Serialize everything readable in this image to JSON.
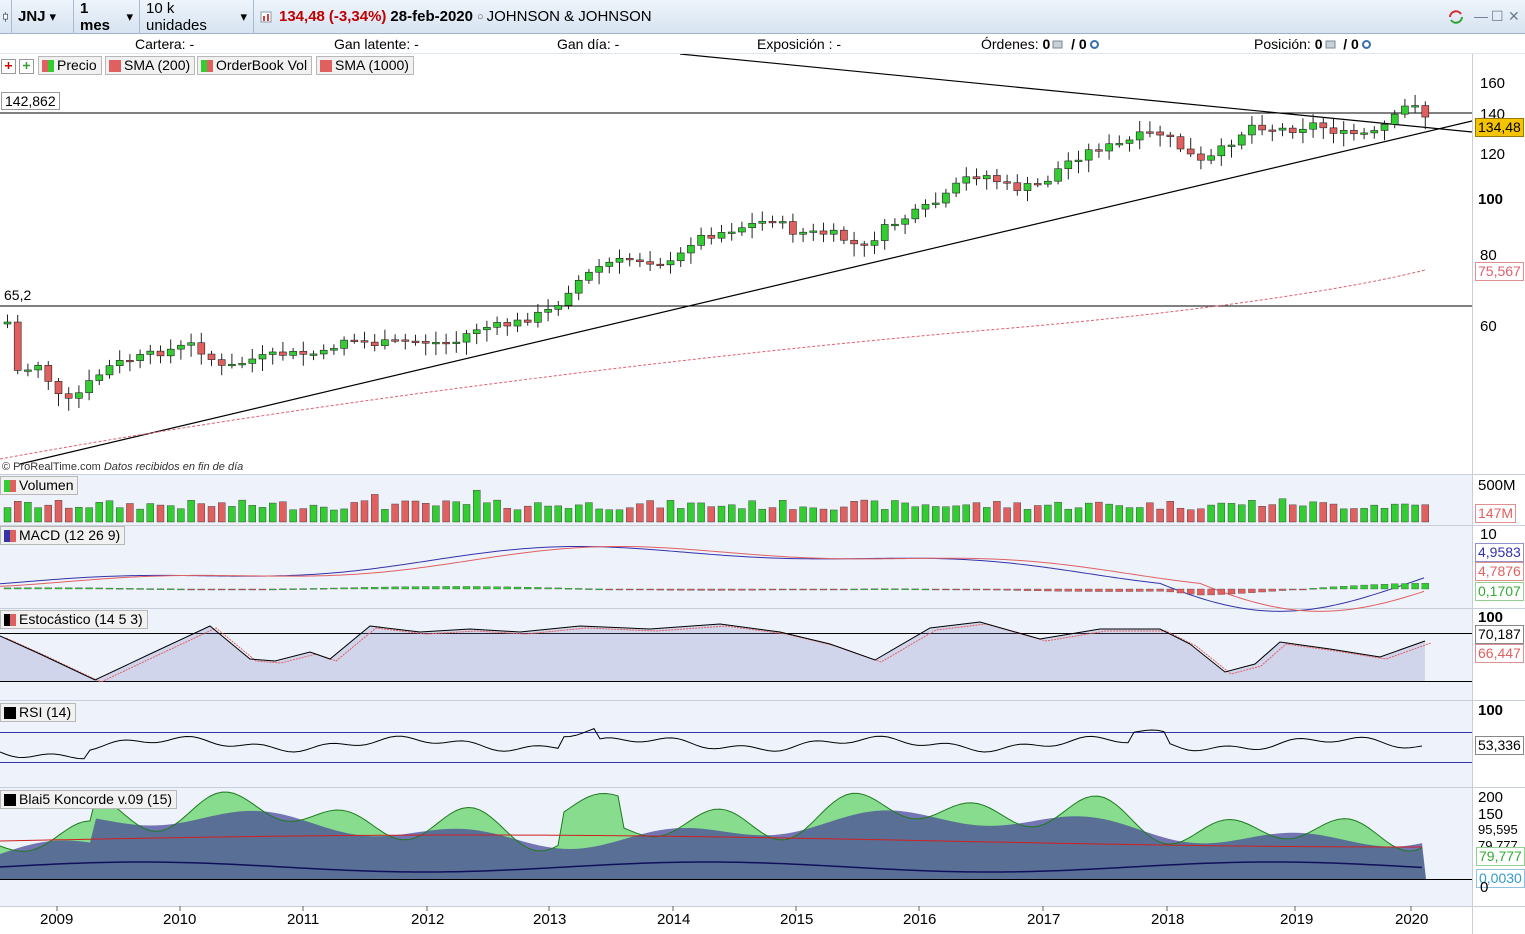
{
  "toolbar": {
    "ticker": "JNJ",
    "period": "1 mes",
    "units": "10 k unidades",
    "last_price": "134,48",
    "change": "(-3,34%)",
    "date": "28-feb-2020",
    "company": "JOHNSON & JOHNSON"
  },
  "infobar": {
    "cartera_label": "Cartera:",
    "cartera_value": "-",
    "gan_latente_label": "Gan latente:",
    "gan_latente_value": "-",
    "gan_dia_label": "Gan día:",
    "gan_dia_value": "-",
    "exposicion_label": "Exposición :",
    "exposicion_value": "-",
    "ordenes_label": "Órdenes:",
    "ordenes_value1": "0",
    "ordenes_value2": "/ 0",
    "posicion_label": "Posición:",
    "posicion_value1": "0",
    "posicion_value2": "/ 0"
  },
  "legend": {
    "precio": "Precio",
    "sma200": "SMA (200)",
    "orderbook": "OrderBook Vol",
    "sma1000": "SMA (1000)"
  },
  "price_panel": {
    "hline_high": "142,862",
    "hline_low": "65,2",
    "credit_site": "© ProRealTime.com",
    "credit_note": "Datos recibidos en fin de día",
    "last_tag": "134,48",
    "sma_tag": "75,567",
    "axis": [
      "160",
      "140",
      "120",
      "100",
      "80",
      "60"
    ]
  },
  "panels": {
    "volume": {
      "label": "Volumen",
      "axis_top": "500M",
      "tag": "147M"
    },
    "macd": {
      "label": "MACD (12 26 9)",
      "axis_top": "10",
      "tags": [
        "4,9583",
        "4,7876",
        "0,1707"
      ]
    },
    "stoch": {
      "label": "Estocástico (14 5 3)",
      "axis_top": "100",
      "tags": [
        "70,187",
        "66,447"
      ]
    },
    "rsi": {
      "label": "RSI (14)",
      "axis_top": "100",
      "tag": "53,336"
    },
    "koncorde": {
      "label": "Blai5 Koncorde v.09 (15)",
      "axis": [
        "200",
        "150",
        "0"
      ],
      "tags": [
        "95,595",
        "79,777",
        "79,777",
        "0,0030"
      ]
    }
  },
  "years": [
    "2009",
    "2010",
    "2011",
    "2012",
    "2013",
    "2014",
    "2015",
    "2016",
    "2017",
    "2018",
    "2019",
    "2020"
  ],
  "colors": {
    "up": "#33cc33",
    "down": "#e06060",
    "sma1000": "#e06070",
    "macd_line": "#3333aa",
    "stoch_fill": "#8080c0",
    "koncorde_blue": "#4a4a9a",
    "koncorde_green": "#33cc33",
    "last_tag_bg": "#f5c400"
  }
}
